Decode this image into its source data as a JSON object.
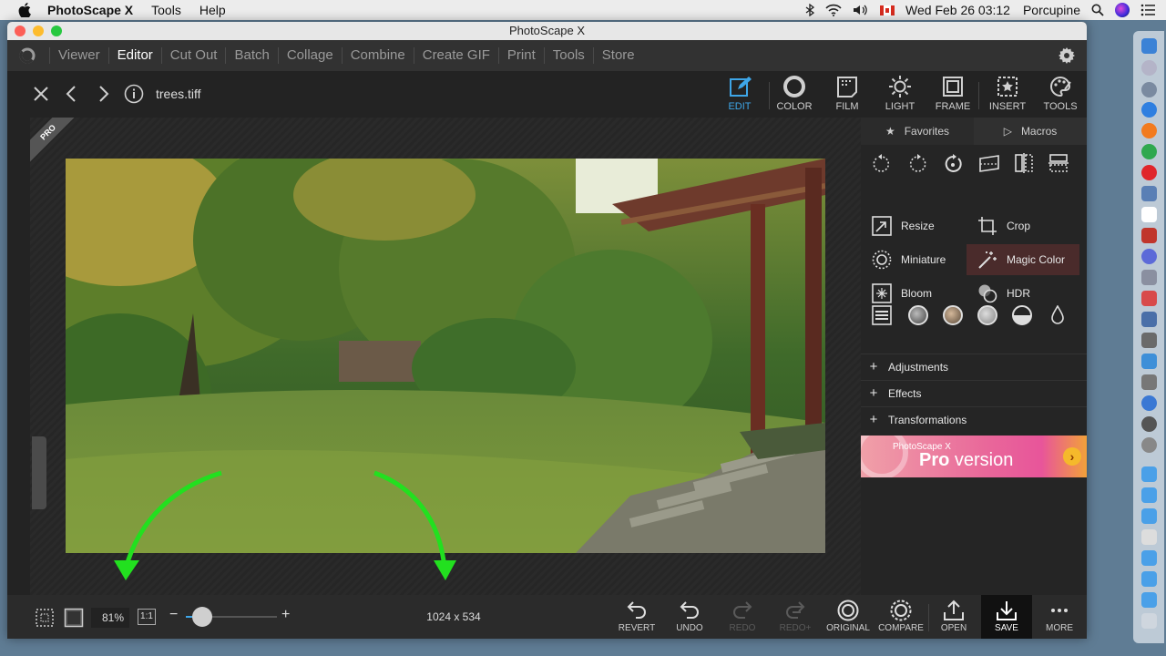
{
  "menubar": {
    "app_name": "PhotoScape X",
    "menus": [
      "Tools",
      "Help"
    ],
    "clock": "Wed Feb 26  03:12",
    "user": "Porcupine"
  },
  "window": {
    "title": "PhotoScape X",
    "tabs": [
      "Viewer",
      "Editor",
      "Cut Out",
      "Batch",
      "Collage",
      "Combine",
      "Create GIF",
      "Print",
      "Tools",
      "Store"
    ],
    "active_tab": "Editor"
  },
  "toolbar": {
    "filename": "trees.tiff",
    "modes": [
      "EDIT",
      "COLOR",
      "FILM",
      "LIGHT",
      "FRAME",
      "INSERT",
      "TOOLS"
    ],
    "active_mode": "EDIT"
  },
  "canvas": {
    "badge_text": "PRO"
  },
  "panel": {
    "tabs": [
      "Favorites",
      "Macros"
    ],
    "tools": [
      "Resize",
      "Crop",
      "Miniature",
      "Magic Color",
      "Bloom",
      "HDR"
    ],
    "highlighted_tool": "Magic Color",
    "sections": [
      "Adjustments",
      "Effects",
      "Transformations"
    ],
    "promo_small": "PhotoScape X",
    "promo_big_bold": "Pro",
    "promo_big_rest": " version"
  },
  "bottom": {
    "zoom": "81%",
    "one_to_one": "1:1",
    "dimensions": "1024 x 534",
    "zoom_level": 0.18,
    "buttons": [
      "REVERT",
      "UNDO",
      "REDO",
      "REDO+",
      "ORIGINAL",
      "COMPARE",
      "OPEN",
      "SAVE",
      "MORE"
    ]
  },
  "colors": {
    "accent": "#3ea6e8",
    "save_bg": "#111111",
    "annotation_green": "#22e01f",
    "annotation_yellow": "#ffee00"
  }
}
